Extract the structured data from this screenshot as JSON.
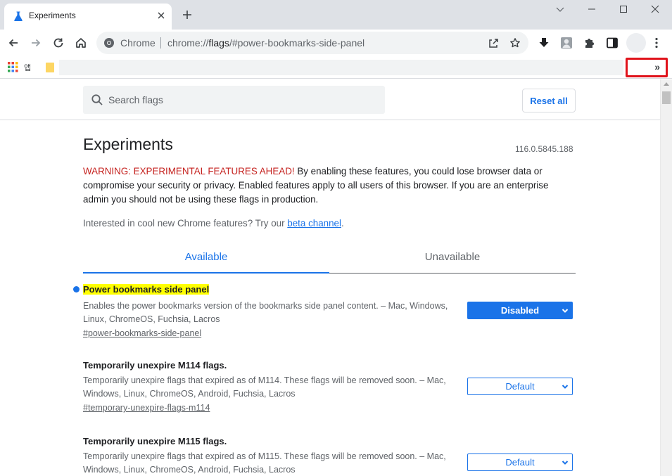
{
  "tab": {
    "title": "Experiments"
  },
  "omnibox": {
    "scheme": "Chrome",
    "url_prefix": "chrome://",
    "url_host": "flags",
    "url_rest": "/#power-bookmarks-side-panel"
  },
  "bookmarks": {
    "app_label": "앱",
    "more_label": "»"
  },
  "header": {
    "search_placeholder": "Search flags",
    "reset_label": "Reset all"
  },
  "main": {
    "title": "Experiments",
    "version": "116.0.5845.188",
    "warning_label": "WARNING: EXPERIMENTAL FEATURES AHEAD!",
    "warning_text": " By enabling these features, you could lose browser data or compromise your security or privacy. Enabled features apply to all users of this browser. If you are an enterprise admin you should not be using these flags in production.",
    "interest_text": "Interested in cool new Chrome features? Try our ",
    "interest_link": "beta channel",
    "interest_end": ".",
    "tabs": [
      {
        "label": "Available"
      },
      {
        "label": "Unavailable"
      }
    ]
  },
  "flags": [
    {
      "title": "Power bookmarks side panel",
      "desc": "Enables the power bookmarks version of the bookmarks side panel content. – Mac, Windows, Linux, ChromeOS, Fuchsia, Lacros",
      "link": "#power-bookmarks-side-panel",
      "value": "Disabled"
    },
    {
      "title": "Temporarily unexpire M114 flags.",
      "desc": "Temporarily unexpire flags that expired as of M114. These flags will be removed soon. – Mac, Windows, Linux, ChromeOS, Android, Fuchsia, Lacros",
      "link": "#temporary-unexpire-flags-m114",
      "value": "Default"
    },
    {
      "title": "Temporarily unexpire M115 flags.",
      "desc": "Temporarily unexpire flags that expired as of M115. These flags will be removed soon. – Mac, Windows, Linux, ChromeOS, Android, Fuchsia, Lacros",
      "link": "",
      "value": "Default"
    }
  ],
  "colors": {
    "accent": "#1a73e8",
    "warning": "#c5221f",
    "highlight": "#ffff00",
    "annotation": "#e0131b"
  }
}
